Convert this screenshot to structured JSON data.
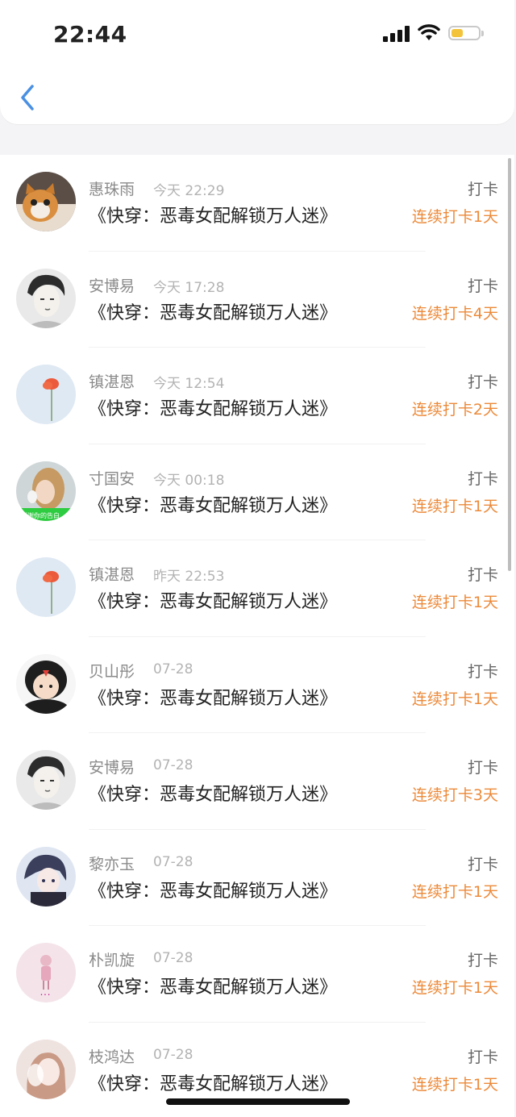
{
  "status_bar": {
    "time": "22:44"
  },
  "colors": {
    "accent": "#ec8a3a",
    "back": "#4a90e2"
  },
  "rows": [
    {
      "name": "惠珠雨",
      "time": "今天 22:29",
      "title": "《快穿：恶毒女配解锁万人迷》",
      "action": "打卡",
      "streak": "连续打卡1天",
      "avatar_icon": "cat-avatar-icon"
    },
    {
      "name": "安博易",
      "time": "今天 17:28",
      "title": "《快穿：恶毒女配解锁万人迷》",
      "action": "打卡",
      "streak": "连续打卡4天",
      "avatar_icon": "sketch-man-avatar-icon"
    },
    {
      "name": "镇湛恩",
      "time": "今天 12:54",
      "title": "《快穿：恶毒女配解锁万人迷》",
      "action": "打卡",
      "streak": "连续打卡2天",
      "avatar_icon": "red-flower-avatar-icon"
    },
    {
      "name": "寸国安",
      "time": "今天 00:18",
      "title": "《快穿：恶毒女配解锁万人迷》",
      "action": "打卡",
      "streak": "连续打卡1天",
      "avatar_icon": "girl-photo-avatar-icon"
    },
    {
      "name": "镇湛恩",
      "time": "昨天 22:53",
      "title": "《快穿：恶毒女配解锁万人迷》",
      "action": "打卡",
      "streak": "连续打卡1天",
      "avatar_icon": "red-flower-avatar-icon"
    },
    {
      "name": "贝山彤",
      "time": "07-28",
      "title": "《快穿：恶毒女配解锁万人迷》",
      "action": "打卡",
      "streak": "连续打卡1天",
      "avatar_icon": "penguin-kid-avatar-icon"
    },
    {
      "name": "安博易",
      "time": "07-28",
      "title": "《快穿：恶毒女配解锁万人迷》",
      "action": "打卡",
      "streak": "连续打卡3天",
      "avatar_icon": "sketch-man-avatar-icon"
    },
    {
      "name": "黎亦玉",
      "time": "07-28",
      "title": "《快穿：恶毒女配解锁万人迷》",
      "action": "打卡",
      "streak": "连续打卡1天",
      "avatar_icon": "anime-avatar-icon"
    },
    {
      "name": "朴凯旋",
      "time": "07-28",
      "title": "《快穿：恶毒女配解锁万人迷》",
      "action": "打卡",
      "streak": "连续打卡1天",
      "avatar_icon": "pink-doll-avatar-icon"
    },
    {
      "name": "枝鸿达",
      "time": "07-28",
      "title": "《快穿：恶毒女配解锁万人迷》",
      "action": "打卡",
      "streak": "连续打卡1天",
      "avatar_icon": "girl-portrait-avatar-icon"
    }
  ]
}
